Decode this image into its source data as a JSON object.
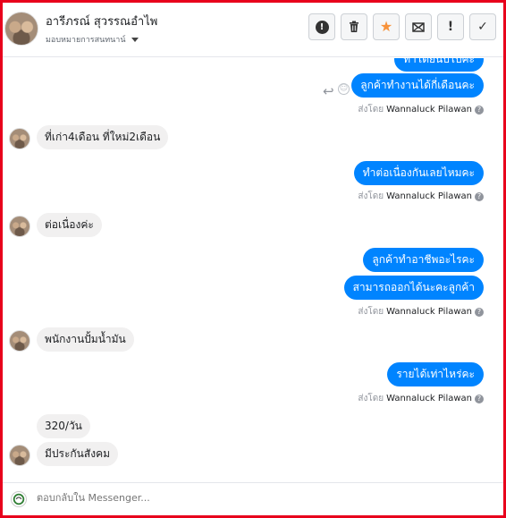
{
  "header": {
    "contact_name": "อารีภรณ์ สุวรรณอำไพ",
    "subtitle": "มอบหมายการสนทนาน์",
    "actions": [
      {
        "name": "spam-button",
        "glyph": "!"
      },
      {
        "name": "delete-button",
        "glyph": "trash"
      },
      {
        "name": "star-button",
        "glyph": "★"
      },
      {
        "name": "mark-unread-button",
        "glyph": "mail"
      },
      {
        "name": "follow-up-button",
        "glyph": "!"
      },
      {
        "name": "done-button",
        "glyph": "✓"
      }
    ]
  },
  "messages": {
    "out_partial": "ทำโดยนับไปคะ",
    "out1": "ลูกค้าทำงานได้กี่เดือนคะ",
    "in1": "ที่เก่า4เดือน ที่ใหม่2เดือน",
    "out2": "ทำต่อเนื่องกันเลยไหมคะ",
    "in2": "ต่อเนื่องค่ะ",
    "out3a": "ลูกค้าทำอาชีพอะไรคะ",
    "out3b": "สามารถออกได้นะคะลูกค้า",
    "in3": "พนักงานปั้มน้ำมัน",
    "out4": "รายได้เท่าไหร่คะ",
    "in4a": "320/วัน",
    "in4b": "มีประกันสังคม"
  },
  "sent_by": {
    "prefix": "ส่งโดย",
    "name": "Wannaluck Pilawan",
    "help": "?"
  },
  "footer": {
    "placeholder": "ตอบกลับใน Messenger..."
  },
  "colors": {
    "accent_blue": "#0084ff",
    "incoming_bg": "#f1f0f0",
    "frame_red": "#e8001c",
    "star_orange": "#f7923a"
  }
}
